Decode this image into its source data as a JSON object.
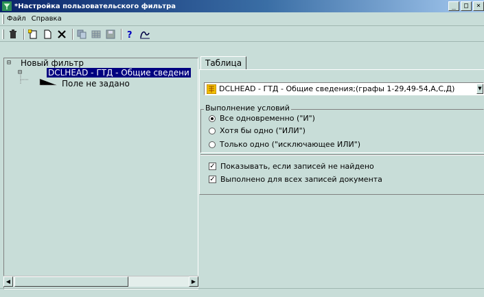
{
  "window": {
    "title": "*Настройка пользовательского фильтра",
    "controls": {
      "minimize": "_",
      "maximize": "□",
      "close": "×"
    }
  },
  "menu": {
    "items": [
      "Файл",
      "Справка"
    ]
  },
  "toolbar": {
    "icons": [
      "trash-icon",
      "new-child-icon",
      "new-icon",
      "delete-x-icon",
      "copy-icon",
      "grid-icon",
      "save-icon",
      "help-icon",
      "info-icon"
    ]
  },
  "tree": {
    "root": "Новый фильтр",
    "selected": "DCLHEAD   - ГТД - Общие сведени",
    "child": "Поле не задано"
  },
  "tab": {
    "label": "Таблица"
  },
  "table_select": {
    "value": "DCLHEAD   - ГТД - Общие сведения;(графы 1-29,49-54,А,С,Д)"
  },
  "conditions": {
    "label": "Выполнение условий",
    "options": [
      "Все одновременно (\"И\")",
      "Хотя бы одно (\"ИЛИ\")",
      "Только одно (\"исключающее ИЛИ\")"
    ],
    "selected_index": 0
  },
  "checks": [
    {
      "label": "Показывать, если записей не найдено",
      "checked": true
    },
    {
      "label": "Выполнено для всех записей документа",
      "checked": true
    }
  ],
  "colors": {
    "titlebar_start": "#0a246a",
    "selection": "#000080",
    "background": "#c8ddd8"
  }
}
